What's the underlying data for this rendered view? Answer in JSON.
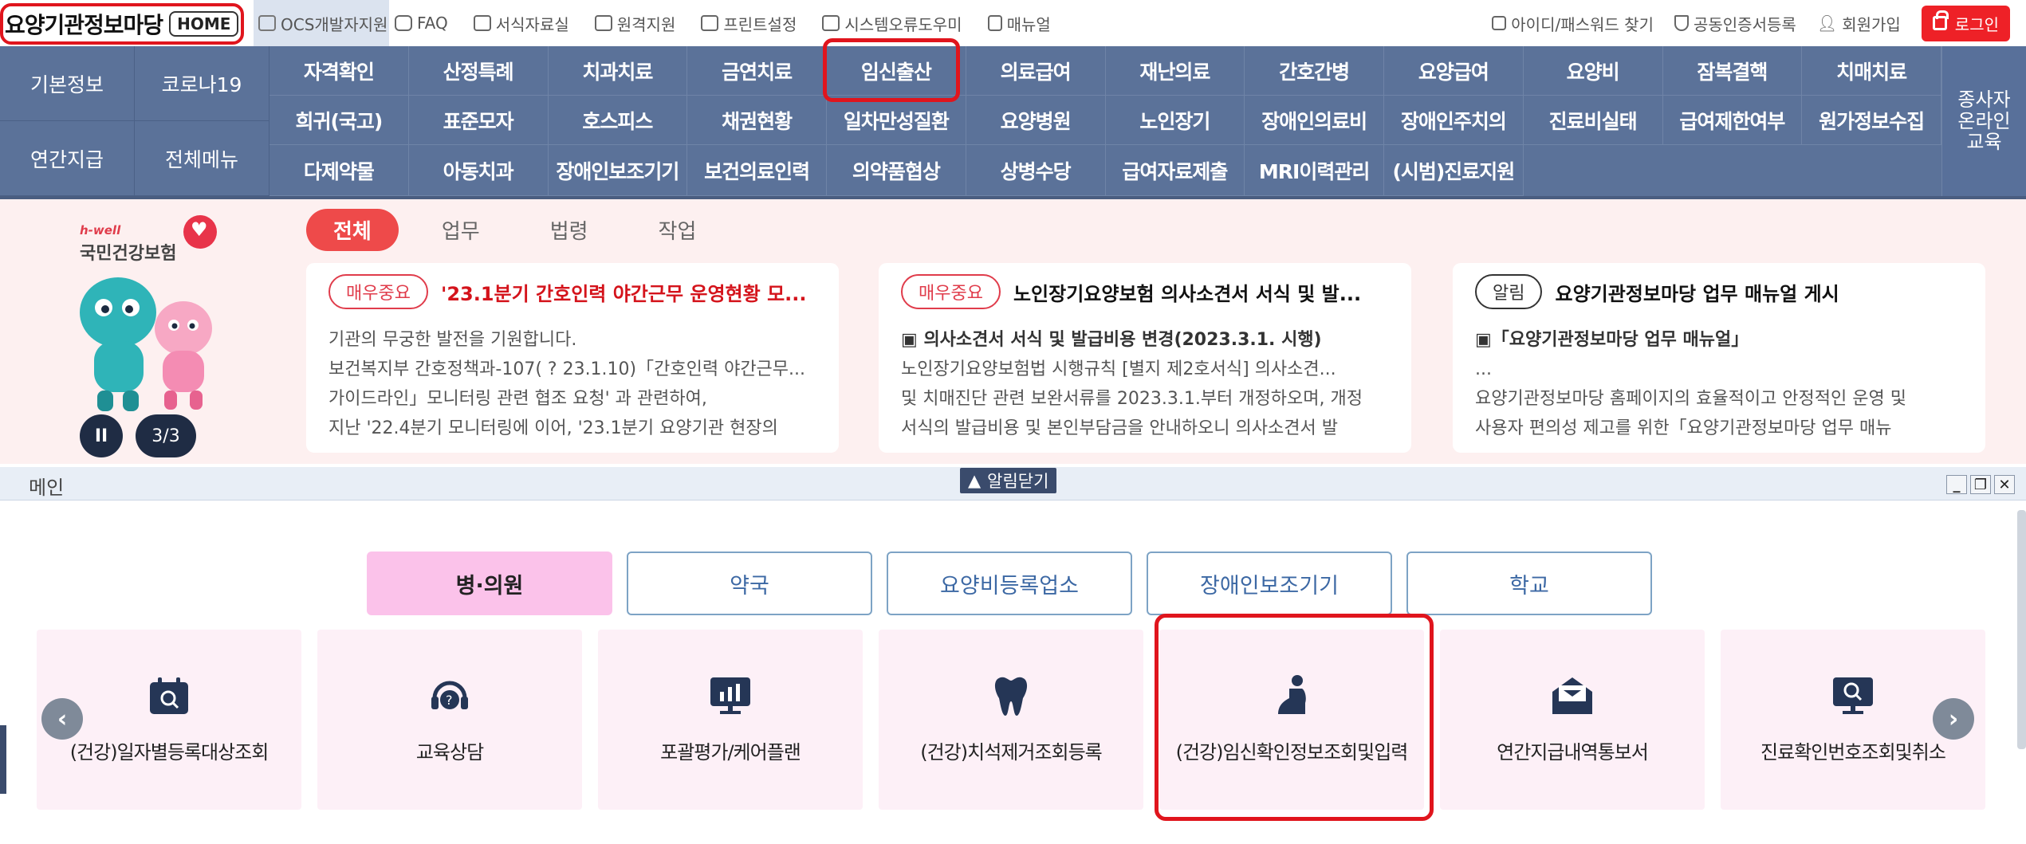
{
  "topbar": {
    "brand": "요양기관정보마당",
    "home": "HOME",
    "ocs": "OCS개발자지원",
    "links": [
      "FAQ",
      "서식자료실",
      "원격지원",
      "프린트설정",
      "시스템오류도우미",
      "매뉴얼"
    ],
    "right_links": [
      "아이디/패스워드 찾기",
      "공동인증서등록",
      "회원가입"
    ],
    "login": "로그인",
    "colors": {
      "accent": "#e0151d",
      "nav": "#5b7299"
    }
  },
  "nav": {
    "left": [
      "기본정보",
      "코로나19",
      "연간지급",
      "전체메뉴"
    ],
    "row1": [
      "자격확인",
      "산정특례",
      "치과치료",
      "금연치료",
      "임신출산",
      "의료급여",
      "재난의료",
      "간호간병",
      "요양급여",
      "요양비",
      "잠복결핵",
      "치매치료"
    ],
    "row2": [
      "희귀(국고)",
      "표준모자",
      "호스피스",
      "채권현황",
      "일차만성질환",
      "요양병원",
      "노인장기",
      "장애인의료비",
      "장애인주치의",
      "진료비실태",
      "급여제한여부",
      "원가정보수집"
    ],
    "row3": [
      "다제약물",
      "아동치과",
      "장애인보조기기",
      "보건의료인력",
      "의약품협상",
      "상병수당",
      "급여자료제출",
      "MRI이력관리",
      "(시범)진료지원"
    ],
    "right": "종사자 온라인 교육"
  },
  "notice": {
    "logo_small": "h-well",
    "logo_name": "국민건강보험",
    "pause": "II",
    "page": "3/3",
    "tabs": [
      "전체",
      "업무",
      "법령",
      "작업"
    ],
    "cards": [
      {
        "badge": "매우중요",
        "title": "'23.1분기 간호인력 야간근무 운영현황 모...",
        "lines": [
          " 기관의 무궁한 발전을 기원합니다.",
          "보건복지부 간호정책과-107( ? 23.1.10)「간호인력 야간근무...",
          "가이드라인」모니터링 관련 협조 요청' 과 관련하여,",
          "지난 '22.4분기 모니터링에 이어, '23.1분기 요양기관 현장의"
        ]
      },
      {
        "badge": "매우중요",
        "title": "노인장기요양보험 의사소견서 서식 및 발...",
        "lines": [
          "▣ 의사소견서 서식 및 발급비용 변경(2023.3.1. 시행)",
          "  노인장기요양보험법 시행규칙 [별지 제2호서식] 의사소견...",
          "및 치매진단 관련 보완서류를 2023.3.1.부터 개정하오며, 개정",
          "서식의 발급비용 및 본인부담금을 안내하오니 의사소견서 발"
        ]
      },
      {
        "badge": "알림",
        "title": "요양기관정보마당 업무 매뉴얼 게시",
        "lines": [
          "▣「요양기관정보마당 업무 매뉴얼」",
          "...",
          "요양기관정보마당 홈페이지의 효율적이고 안정적인 운영 및",
          "사용자 편의성 제고를 위한「요양기관정보마당 업무 매뉴"
        ]
      }
    ]
  },
  "main": {
    "title": "메인",
    "close_notice": "알림닫기",
    "window_controls": [
      "_",
      "❐",
      "✕"
    ],
    "categories": [
      "병·의원",
      "약국",
      "요양비등록업소",
      "장애인보조기기",
      "학교"
    ],
    "cards": [
      {
        "label": "(건강)일자별등록대상조회",
        "icon": "calendar-search-icon"
      },
      {
        "label": "교육상담",
        "icon": "headset-help-icon"
      },
      {
        "label": "포괄평가/케어플랜",
        "icon": "chart-board-icon"
      },
      {
        "label": "(건강)치석제거조회등록",
        "icon": "tooth-icon"
      },
      {
        "label": "(건강)임신확인정보조회및입력",
        "icon": "pregnant-icon"
      },
      {
        "label": "연간지급내역통보서",
        "icon": "mail-open-icon"
      },
      {
        "label": "진료확인번호조회및취소",
        "icon": "monitor-search-icon"
      }
    ],
    "prev": "‹",
    "next": "›"
  }
}
